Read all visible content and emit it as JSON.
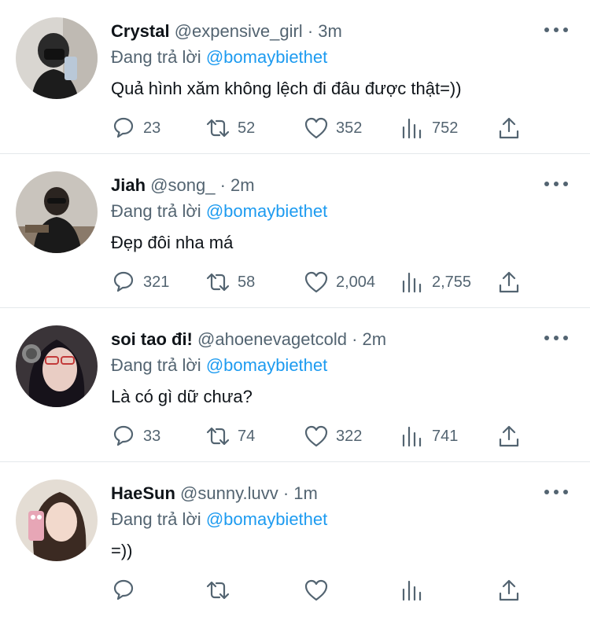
{
  "tweets": [
    {
      "name": "Crystal",
      "handle": "@expensive_girl",
      "dot": "·",
      "time": "3m",
      "reply_prefix": "Đang trả lời",
      "reply_to": "@bomaybiethet",
      "text": "Quả hình xăm không lệch đi đâu được thật=))",
      "replies": "23",
      "retweets": "52",
      "likes": "352",
      "views": "752"
    },
    {
      "name": "Jiah",
      "handle": "@song_",
      "dot": "·",
      "time": "2m",
      "reply_prefix": "Đang trả lời",
      "reply_to": "@bomaybiethet",
      "text": "Đẹp đôi nha má",
      "replies": "321",
      "retweets": "58",
      "likes": "2,004",
      "views": "2,755"
    },
    {
      "name": "soi tao đi!",
      "handle": "@ahoenevagetcold",
      "dot": "·",
      "time": "2m",
      "reply_prefix": "Đang trả lời",
      "reply_to": "@bomaybiethet",
      "text": "Là có gì dữ chưa?",
      "replies": "33",
      "retweets": "74",
      "likes": "322",
      "views": "741"
    },
    {
      "name": "HaeSun",
      "handle": "@sunny.luvv",
      "dot": "·",
      "time": "1m",
      "reply_prefix": "Đang trả lời",
      "reply_to": "@bomaybiethet",
      "text": "=))",
      "replies": "",
      "retweets": "",
      "likes": "",
      "views": ""
    }
  ],
  "icons": {
    "more": "more-options-icon",
    "reply": "reply-icon",
    "retweet": "retweet-icon",
    "like": "heart-icon",
    "views": "views-chart-icon",
    "share": "share-icon"
  },
  "colors": {
    "mention": "#1d9bf0",
    "secondary_text": "#536471",
    "divider": "#e4e8eb"
  }
}
